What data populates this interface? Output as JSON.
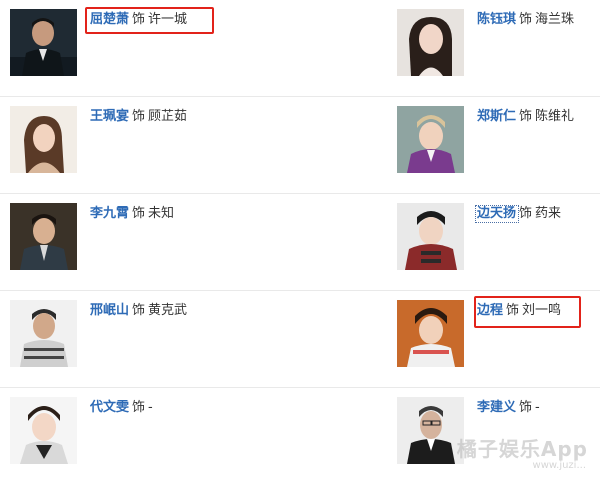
{
  "cast": [
    {
      "left": {
        "actor": "屈楚萧",
        "sep": "饰",
        "role": "许一城"
      },
      "right": {
        "actor": "陈钰琪",
        "sep": "饰",
        "role": "海兰珠"
      }
    },
    {
      "left": {
        "actor": "王珮宴",
        "sep": "饰",
        "role": "顾芷茹"
      },
      "right": {
        "actor": "郑斯仁",
        "sep": "饰",
        "role": "陈维礼"
      }
    },
    {
      "left": {
        "actor": "李九霄",
        "sep": "饰",
        "role": "未知"
      },
      "right": {
        "actor": "边天扬",
        "sep": "饰",
        "role": "药来"
      }
    },
    {
      "left": {
        "actor": "邢岷山",
        "sep": "饰",
        "role": "黄克武"
      },
      "right": {
        "actor": "边程",
        "sep": "饰",
        "role": "刘一鸣"
      }
    },
    {
      "left": {
        "actor": "代文雯",
        "sep": "饰",
        "role": "-"
      },
      "right": {
        "actor": "李建义",
        "sep": "饰",
        "role": "-"
      }
    }
  ],
  "colors": {
    "actor_link": "#2e6bb6",
    "highlight": "#e2231a"
  },
  "watermark": {
    "main": "橘子娱乐App",
    "sub": "www.juzi..."
  }
}
